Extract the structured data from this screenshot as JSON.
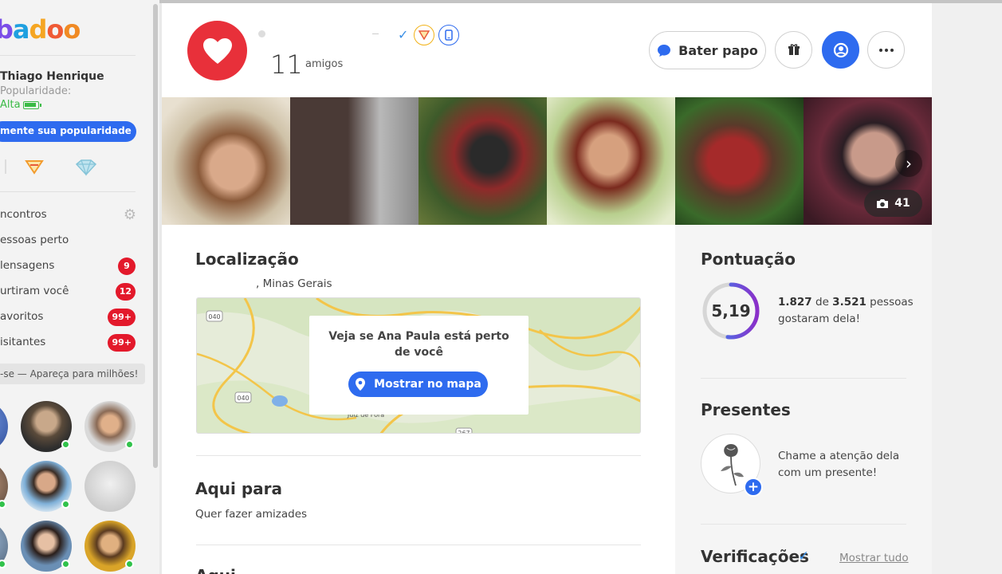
{
  "sidebar": {
    "logo": "badoo",
    "user": {
      "name": "Thiago Henrique",
      "popularity_label": "Popularidade:",
      "popularity_value": "Alta"
    },
    "boost_button": "mente sua popularidade",
    "nav": [
      {
        "label": "ncontros",
        "badge": null,
        "icon": "gear-icon"
      },
      {
        "label": "essoas perto",
        "badge": null
      },
      {
        "label": "lensagens",
        "badge": "9"
      },
      {
        "label": "urtiram você",
        "badge": "12"
      },
      {
        "label": "avoritos",
        "badge": "99+"
      },
      {
        "label": "isitantes",
        "badge": "99+"
      }
    ],
    "promo": "-se — Apareça para milhões!"
  },
  "profile": {
    "friends_count": "11",
    "friends_label": "amigos",
    "verified_icon": "check-icon",
    "chat_button": "Bater papo",
    "photo_count": "41"
  },
  "location": {
    "title": "Localização",
    "place": ", Minas Gerais",
    "map_question": "Veja se Ana Paula está perto de você",
    "map_button": "Mostrar no mapa",
    "map_labels": [
      "040",
      "040",
      "267",
      "267",
      "Juiz de Fora",
      "Juiz de Fora"
    ]
  },
  "here_for": {
    "title": "Aqui para",
    "value": "Quer fazer amizades"
  },
  "next_section_title": "Aqui",
  "score": {
    "title": "Pontuação",
    "value": "5,19",
    "likes": "1.827",
    "of_word": "de",
    "total": "3.521",
    "suffix": "pessoas gostaram dela!",
    "fraction": 0.519
  },
  "gifts": {
    "title": "Presentes",
    "text": "Chame a atenção dela com um presente!"
  },
  "verifications": {
    "title": "Verificações",
    "show_all": "Mostrar tudo"
  },
  "colors": {
    "accent": "#2e6bef",
    "heart": "#e8303a",
    "badge_red": "#e3192b",
    "online": "#31c24b"
  }
}
